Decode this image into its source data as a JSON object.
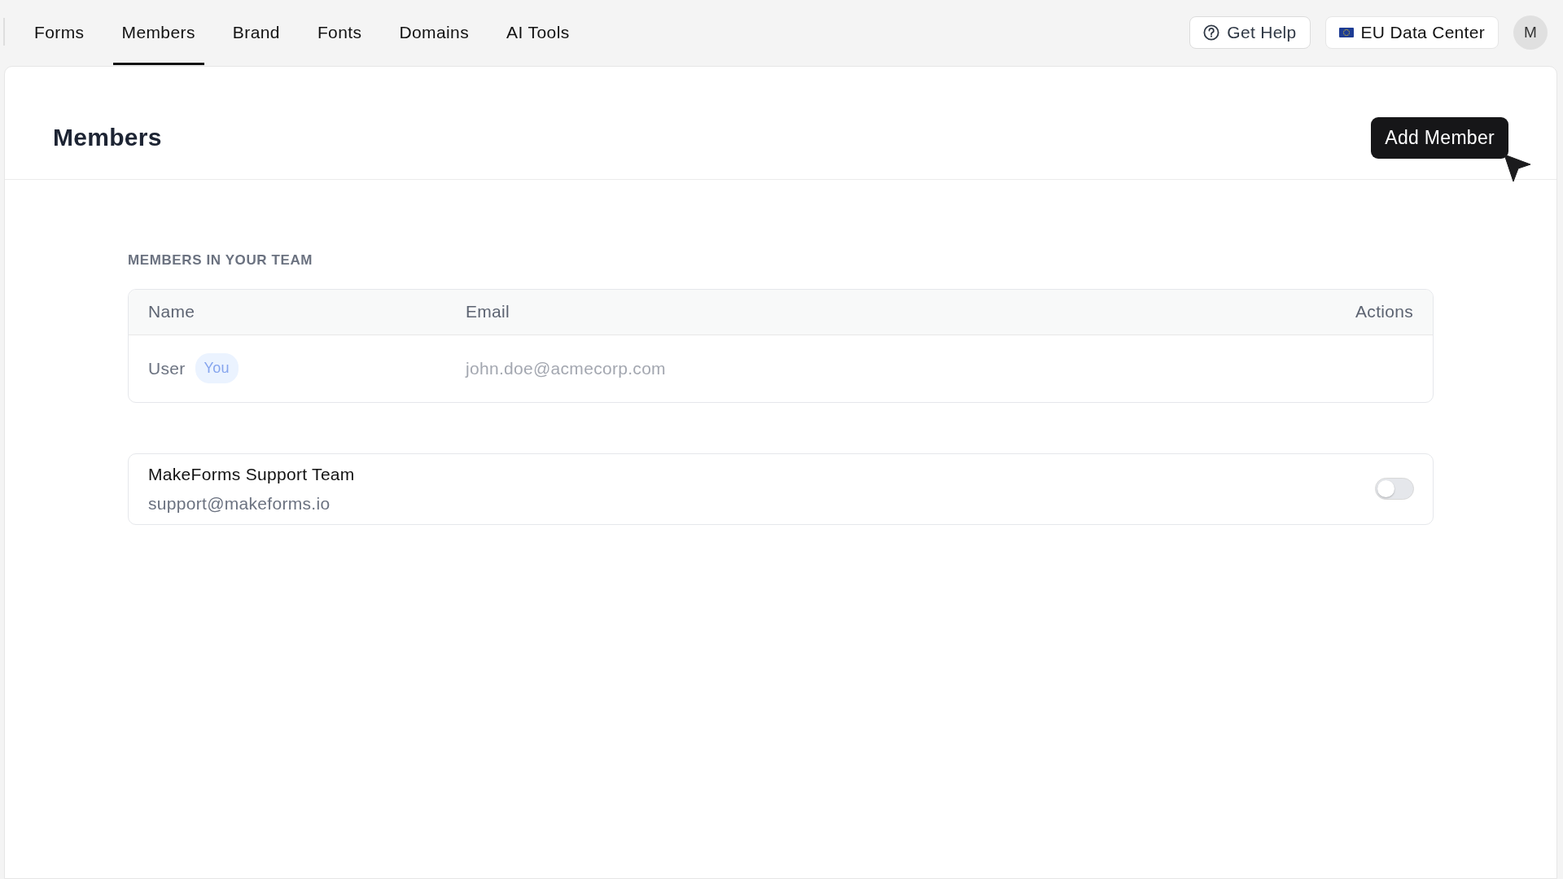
{
  "nav": {
    "tabs": [
      {
        "label": "Forms",
        "selected": false
      },
      {
        "label": "Members",
        "selected": true
      },
      {
        "label": "Brand",
        "selected": false
      },
      {
        "label": "Fonts",
        "selected": false
      },
      {
        "label": "Domains",
        "selected": false
      },
      {
        "label": "AI Tools",
        "selected": false
      }
    ],
    "help_button": {
      "label": "Get Help"
    },
    "region_button": {
      "label": "EU Data Center"
    },
    "avatar": {
      "initial": "M"
    }
  },
  "page": {
    "title": "Members",
    "add_button": {
      "label": "Add Member"
    }
  },
  "section": {
    "heading": "MEMBERS IN YOUR TEAM"
  },
  "table": {
    "columns": [
      "Name",
      "Email",
      "Actions"
    ],
    "rows": [
      {
        "name": "User",
        "badge": "You",
        "email": "john.doe@acmecorp.com"
      }
    ]
  },
  "support_access": {
    "name": "MakeForms Support Team",
    "email": "support@makeforms.io",
    "on": false
  }
}
